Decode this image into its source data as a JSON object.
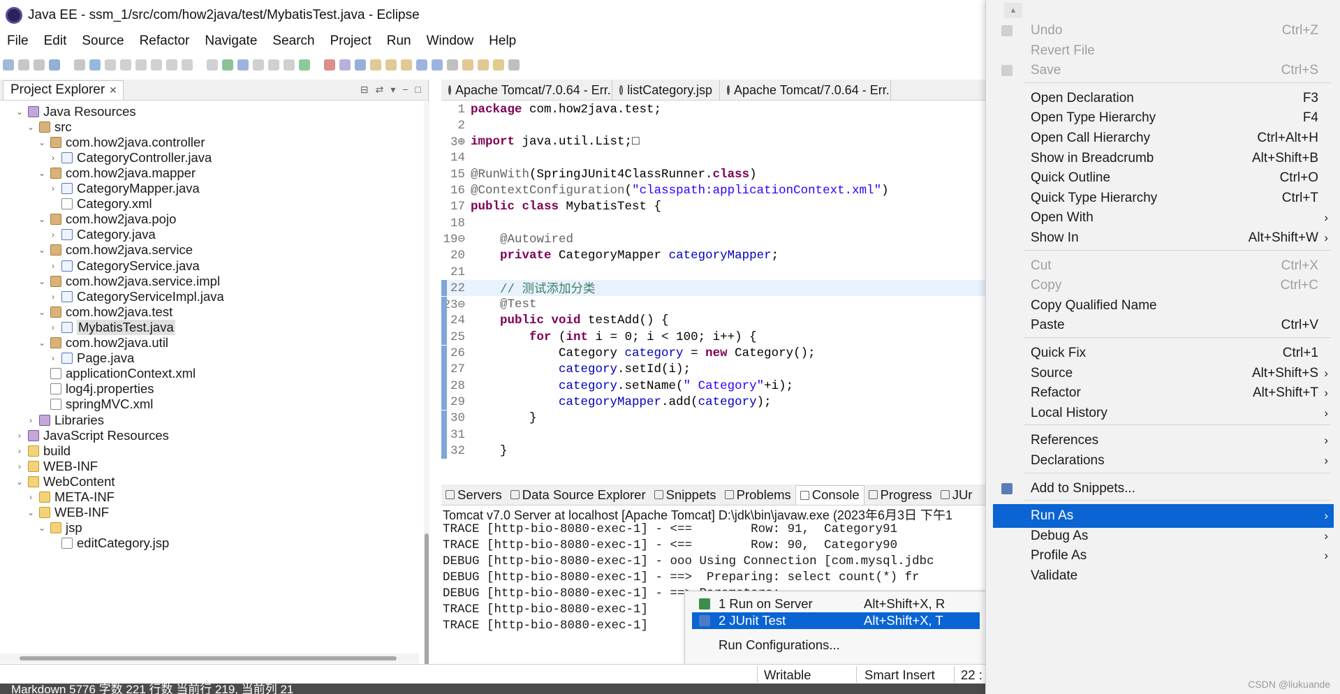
{
  "window": {
    "title": "Java EE - ssm_1/src/com/how2java/test/MybatisTest.java - Eclipse"
  },
  "menubar": [
    "File",
    "Edit",
    "Source",
    "Refactor",
    "Navigate",
    "Search",
    "Project",
    "Run",
    "Window",
    "Help"
  ],
  "explorer": {
    "tab_label": "Project Explorer",
    "tree": [
      {
        "label": "Java Resources",
        "arrow": "⌄",
        "icon": "lib"
      },
      {
        "label": "src",
        "arrow": "⌄",
        "icon": "pkg"
      },
      {
        "label": "com.how2java.controller",
        "arrow": "⌄",
        "icon": "pkg"
      },
      {
        "label": "CategoryController.java",
        "arrow": "›",
        "icon": "java"
      },
      {
        "label": "com.how2java.mapper",
        "arrow": "⌄",
        "icon": "pkg"
      },
      {
        "label": "CategoryMapper.java",
        "arrow": "›",
        "icon": "java"
      },
      {
        "label": "Category.xml",
        "arrow": "",
        "icon": "xml"
      },
      {
        "label": "com.how2java.pojo",
        "arrow": "⌄",
        "icon": "pkg"
      },
      {
        "label": "Category.java",
        "arrow": "›",
        "icon": "java"
      },
      {
        "label": "com.how2java.service",
        "arrow": "⌄",
        "icon": "pkg"
      },
      {
        "label": "CategoryService.java",
        "arrow": "›",
        "icon": "java"
      },
      {
        "label": "com.how2java.service.impl",
        "arrow": "⌄",
        "icon": "pkg"
      },
      {
        "label": "CategoryServiceImpl.java",
        "arrow": "›",
        "icon": "java"
      },
      {
        "label": "com.how2java.test",
        "arrow": "⌄",
        "icon": "pkg"
      },
      {
        "label": "MybatisTest.java",
        "arrow": "›",
        "icon": "java",
        "selected": true
      },
      {
        "label": "com.how2java.util",
        "arrow": "⌄",
        "icon": "pkg"
      },
      {
        "label": "Page.java",
        "arrow": "›",
        "icon": "java"
      },
      {
        "label": "applicationContext.xml",
        "arrow": "",
        "icon": "xml"
      },
      {
        "label": "log4j.properties",
        "arrow": "",
        "icon": "xml"
      },
      {
        "label": "springMVC.xml",
        "arrow": "",
        "icon": "xml"
      },
      {
        "label": "Libraries",
        "arrow": "›",
        "icon": "lib"
      },
      {
        "label": "JavaScript Resources",
        "arrow": "›",
        "icon": "lib"
      },
      {
        "label": "build",
        "arrow": "›",
        "icon": "folder"
      },
      {
        "label": "WEB-INF",
        "arrow": "›",
        "icon": "folder"
      },
      {
        "label": "WebContent",
        "arrow": "⌄",
        "icon": "folder"
      },
      {
        "label": "META-INF",
        "arrow": "›",
        "icon": "folder"
      },
      {
        "label": "WEB-INF",
        "arrow": "⌄",
        "icon": "folder"
      },
      {
        "label": "jsp",
        "arrow": "⌄",
        "icon": "folder"
      },
      {
        "label": "editCategory.jsp",
        "arrow": "",
        "icon": "xml"
      }
    ]
  },
  "editor": {
    "tabs": [
      "Apache Tomcat/7.0.64 - Err...",
      "listCategory.jsp",
      "Apache Tomcat/7.0.64 - Err..."
    ],
    "lines": [
      {
        "n": "1",
        "html": "<span class='kw'>package</span> com.how2java.test;"
      },
      {
        "n": "2",
        "html": ""
      },
      {
        "n": "3⊕",
        "html": "<span class='kw'>import</span> java.util.List;□"
      },
      {
        "n": "14",
        "html": ""
      },
      {
        "n": "15",
        "html": "<span class='ann'>@RunWith</span>(SpringJUnit4ClassRunner.<span class='kw'>class</span>)"
      },
      {
        "n": "16",
        "html": "<span class='ann'>@ContextConfiguration</span>(<span class='str'>\"classpath:applicationContext.xml\"</span>)"
      },
      {
        "n": "17",
        "html": "<span class='kw'>public class</span> MybatisTest {"
      },
      {
        "n": "18",
        "html": ""
      },
      {
        "n": "19⊖",
        "html": "    <span class='ann'>@Autowired</span>"
      },
      {
        "n": "20",
        "html": "    <span class='kw'>private</span> CategoryMapper <span class='fld'>categoryMapper</span>;"
      },
      {
        "n": "21",
        "html": ""
      },
      {
        "n": "22",
        "html": "    <span class='cmt'>// 测试添加分类</span>",
        "highlight": true
      },
      {
        "n": "23⊖",
        "html": "    <span class='ann'>@Test</span>"
      },
      {
        "n": "24",
        "html": "    <span class='kw'>public void</span> testAdd() {"
      },
      {
        "n": "25",
        "html": "        <span class='kw'>for</span> (<span class='kw'>int</span> i = 0; i &lt; 100; i++) {"
      },
      {
        "n": "26",
        "html": "            Category <span class='fld'>category</span> = <span class='kw'>new</span> Category();"
      },
      {
        "n": "27",
        "html": "            <span class='fld'>category</span>.setId(i);"
      },
      {
        "n": "28",
        "html": "            <span class='fld'>category</span>.setName(<span class='str'>\" Category\"</span>+i);"
      },
      {
        "n": "29",
        "html": "            <span class='fld'>categoryMapper</span>.add(<span class='fld'>category</span>);"
      },
      {
        "n": "30",
        "html": "        }"
      },
      {
        "n": "31",
        "html": ""
      },
      {
        "n": "32",
        "html": "    }"
      }
    ]
  },
  "console": {
    "tabs": [
      "Servers",
      "Data Source Explorer",
      "Snippets",
      "Problems",
      "Console",
      "Progress",
      "JUr"
    ],
    "status": "Tomcat v7.0 Server at localhost [Apache Tomcat] D:\\jdk\\bin\\javaw.exe (2023年6月3日 下午1",
    "lines": [
      "TRACE [http-bio-8080-exec-1] - <==        Row: 91,  Category91",
      "TRACE [http-bio-8080-exec-1] - <==        Row: 90,  Category90",
      "DEBUG [http-bio-8080-exec-1] - ooo Using Connection [com.mysql.jdbc",
      "DEBUG [http-bio-8080-exec-1] - ==>  Preparing: select count(*) fr",
      "DEBUG [http-bio-8080-exec-1] - ==> Parameters:",
      "TRACE [http-bio-8080-exec-1]",
      "TRACE [http-bio-8080-exec-1]"
    ]
  },
  "run_submenu": [
    {
      "label": "1 Run on Server",
      "shortcut": "Alt+Shift+X, R"
    },
    {
      "label": "2 JUnit Test",
      "shortcut": "Alt+Shift+X, T",
      "selected": true
    },
    {
      "label": "Run Configurations...",
      "shortcut": ""
    }
  ],
  "statusbar": {
    "writable": "Writable",
    "insert_mode": "Smart Insert",
    "position": "22 :"
  },
  "markdown_bar": "Markdown  5776 字数  221 行数  当前行 219, 当前列 21",
  "context_menu": [
    {
      "label": "Undo",
      "shortcut": "Ctrl+Z",
      "disabled": true,
      "icon": true
    },
    {
      "label": "Revert File",
      "shortcut": "",
      "disabled": true
    },
    {
      "label": "Save",
      "shortcut": "Ctrl+S",
      "disabled": true,
      "icon": true
    },
    {
      "sep": true
    },
    {
      "label": "Open Declaration",
      "shortcut": "F3"
    },
    {
      "label": "Open Type Hierarchy",
      "shortcut": "F4"
    },
    {
      "label": "Open Call Hierarchy",
      "shortcut": "Ctrl+Alt+H"
    },
    {
      "label": "Show in Breadcrumb",
      "shortcut": "Alt+Shift+B"
    },
    {
      "label": "Quick Outline",
      "shortcut": "Ctrl+O"
    },
    {
      "label": "Quick Type Hierarchy",
      "shortcut": "Ctrl+T"
    },
    {
      "label": "Open With",
      "shortcut": "",
      "submenu": true
    },
    {
      "label": "Show In",
      "shortcut": "Alt+Shift+W",
      "submenu": true
    },
    {
      "sep": true
    },
    {
      "label": "Cut",
      "shortcut": "Ctrl+X",
      "disabled": true
    },
    {
      "label": "Copy",
      "shortcut": "Ctrl+C",
      "disabled": true
    },
    {
      "label": "Copy Qualified Name",
      "shortcut": ""
    },
    {
      "label": "Paste",
      "shortcut": "Ctrl+V"
    },
    {
      "sep": true
    },
    {
      "label": "Quick Fix",
      "shortcut": "Ctrl+1"
    },
    {
      "label": "Source",
      "shortcut": "Alt+Shift+S",
      "submenu": true
    },
    {
      "label": "Refactor",
      "shortcut": "Alt+Shift+T",
      "submenu": true
    },
    {
      "label": "Local History",
      "shortcut": "",
      "submenu": true
    },
    {
      "sep": true
    },
    {
      "label": "References",
      "shortcut": "",
      "submenu": true
    },
    {
      "label": "Declarations",
      "shortcut": "",
      "submenu": true
    },
    {
      "sep": true
    },
    {
      "label": "Add to Snippets...",
      "shortcut": "",
      "icon": true
    },
    {
      "sep": true
    },
    {
      "label": "Run As",
      "shortcut": "",
      "submenu": true,
      "selected": true
    },
    {
      "label": "Debug As",
      "shortcut": "",
      "submenu": true
    },
    {
      "label": "Profile As",
      "shortcut": "",
      "submenu": true
    },
    {
      "label": "Validate",
      "shortcut": ""
    }
  ],
  "watermark": "CSDN @liukuande"
}
